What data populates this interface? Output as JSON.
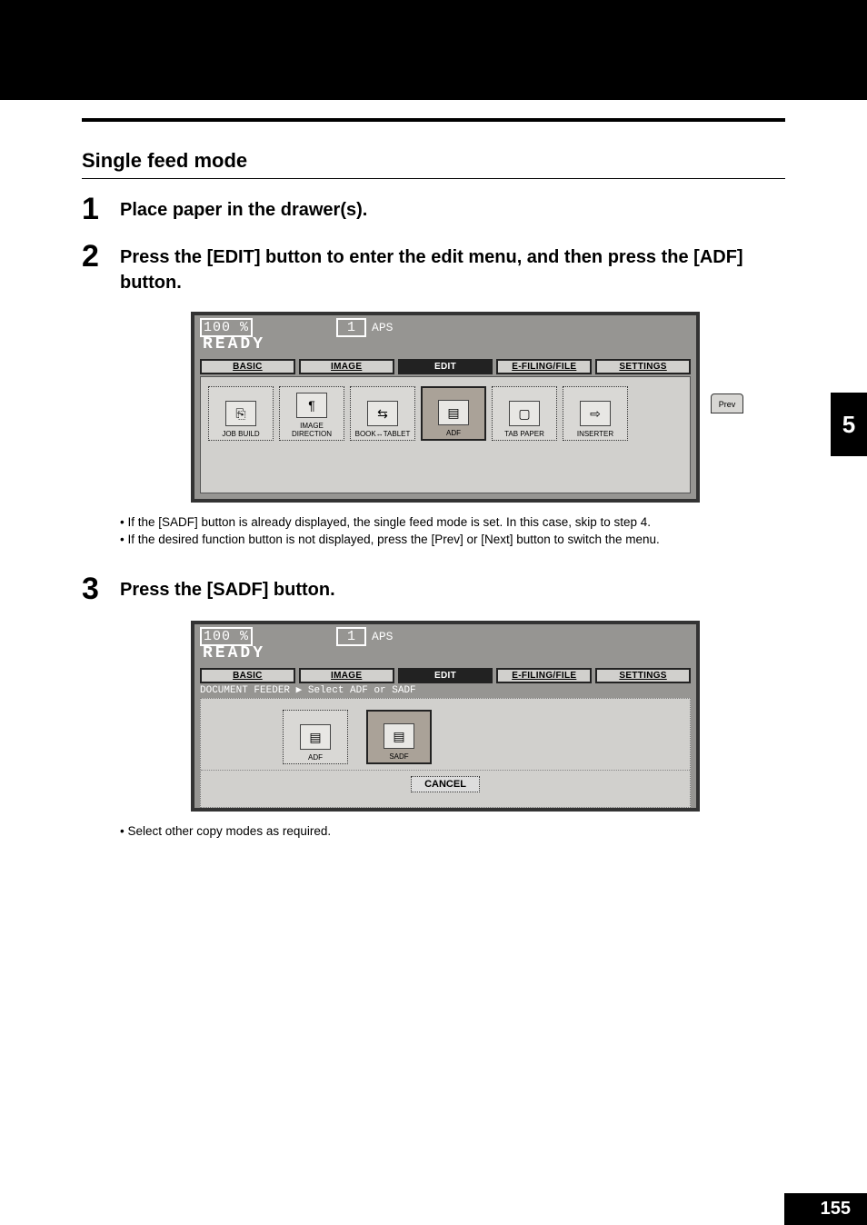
{
  "section_title": "Single feed mode",
  "steps": {
    "s1": {
      "num": "1",
      "text": "Place paper in the drawer(s)."
    },
    "s2": {
      "num": "2",
      "text": "Press the [EDIT] button to enter the edit menu, and then press the [ADF] button."
    },
    "s3": {
      "num": "3",
      "text": "Press the [SADF] button."
    }
  },
  "screenshot1": {
    "percent": "100 %",
    "qty": "1",
    "mode": "APS",
    "ready": "READY",
    "tabs": {
      "basic": "BASIC",
      "image": "IMAGE",
      "edit": "EDIT",
      "efiling": "E-FILING/FILE",
      "settings": "SETTINGS"
    },
    "buttons": {
      "jobbuild": "JOB BUILD",
      "imagedir": "IMAGE DIRECTION",
      "booktab": "BOOK↔TABLET",
      "adf": "ADF",
      "tabpaper": "TAB PAPER",
      "inserter": "INSERTER"
    },
    "prev": "Prev"
  },
  "notes_after_s2": [
    "If the [SADF] button is already displayed, the single feed mode is set. In this case, skip to step 4.",
    "If the desired function button is not displayed, press the [Prev] or [Next] button to switch the menu."
  ],
  "screenshot2": {
    "percent": "100 %",
    "qty": "1",
    "mode": "APS",
    "ready": "READY",
    "tabs": {
      "basic": "BASIC",
      "image": "IMAGE",
      "edit": "EDIT",
      "efiling": "E-FILING/FILE",
      "settings": "SETTINGS"
    },
    "subtext": "DOCUMENT FEEDER    ▶ Select ADF or SADF",
    "buttons": {
      "adf": "ADF",
      "sadf": "SADF"
    },
    "cancel": "CANCEL"
  },
  "notes_after_s3": [
    "Select other copy modes as required."
  ],
  "chapter_tab": "5",
  "page_number": "155"
}
